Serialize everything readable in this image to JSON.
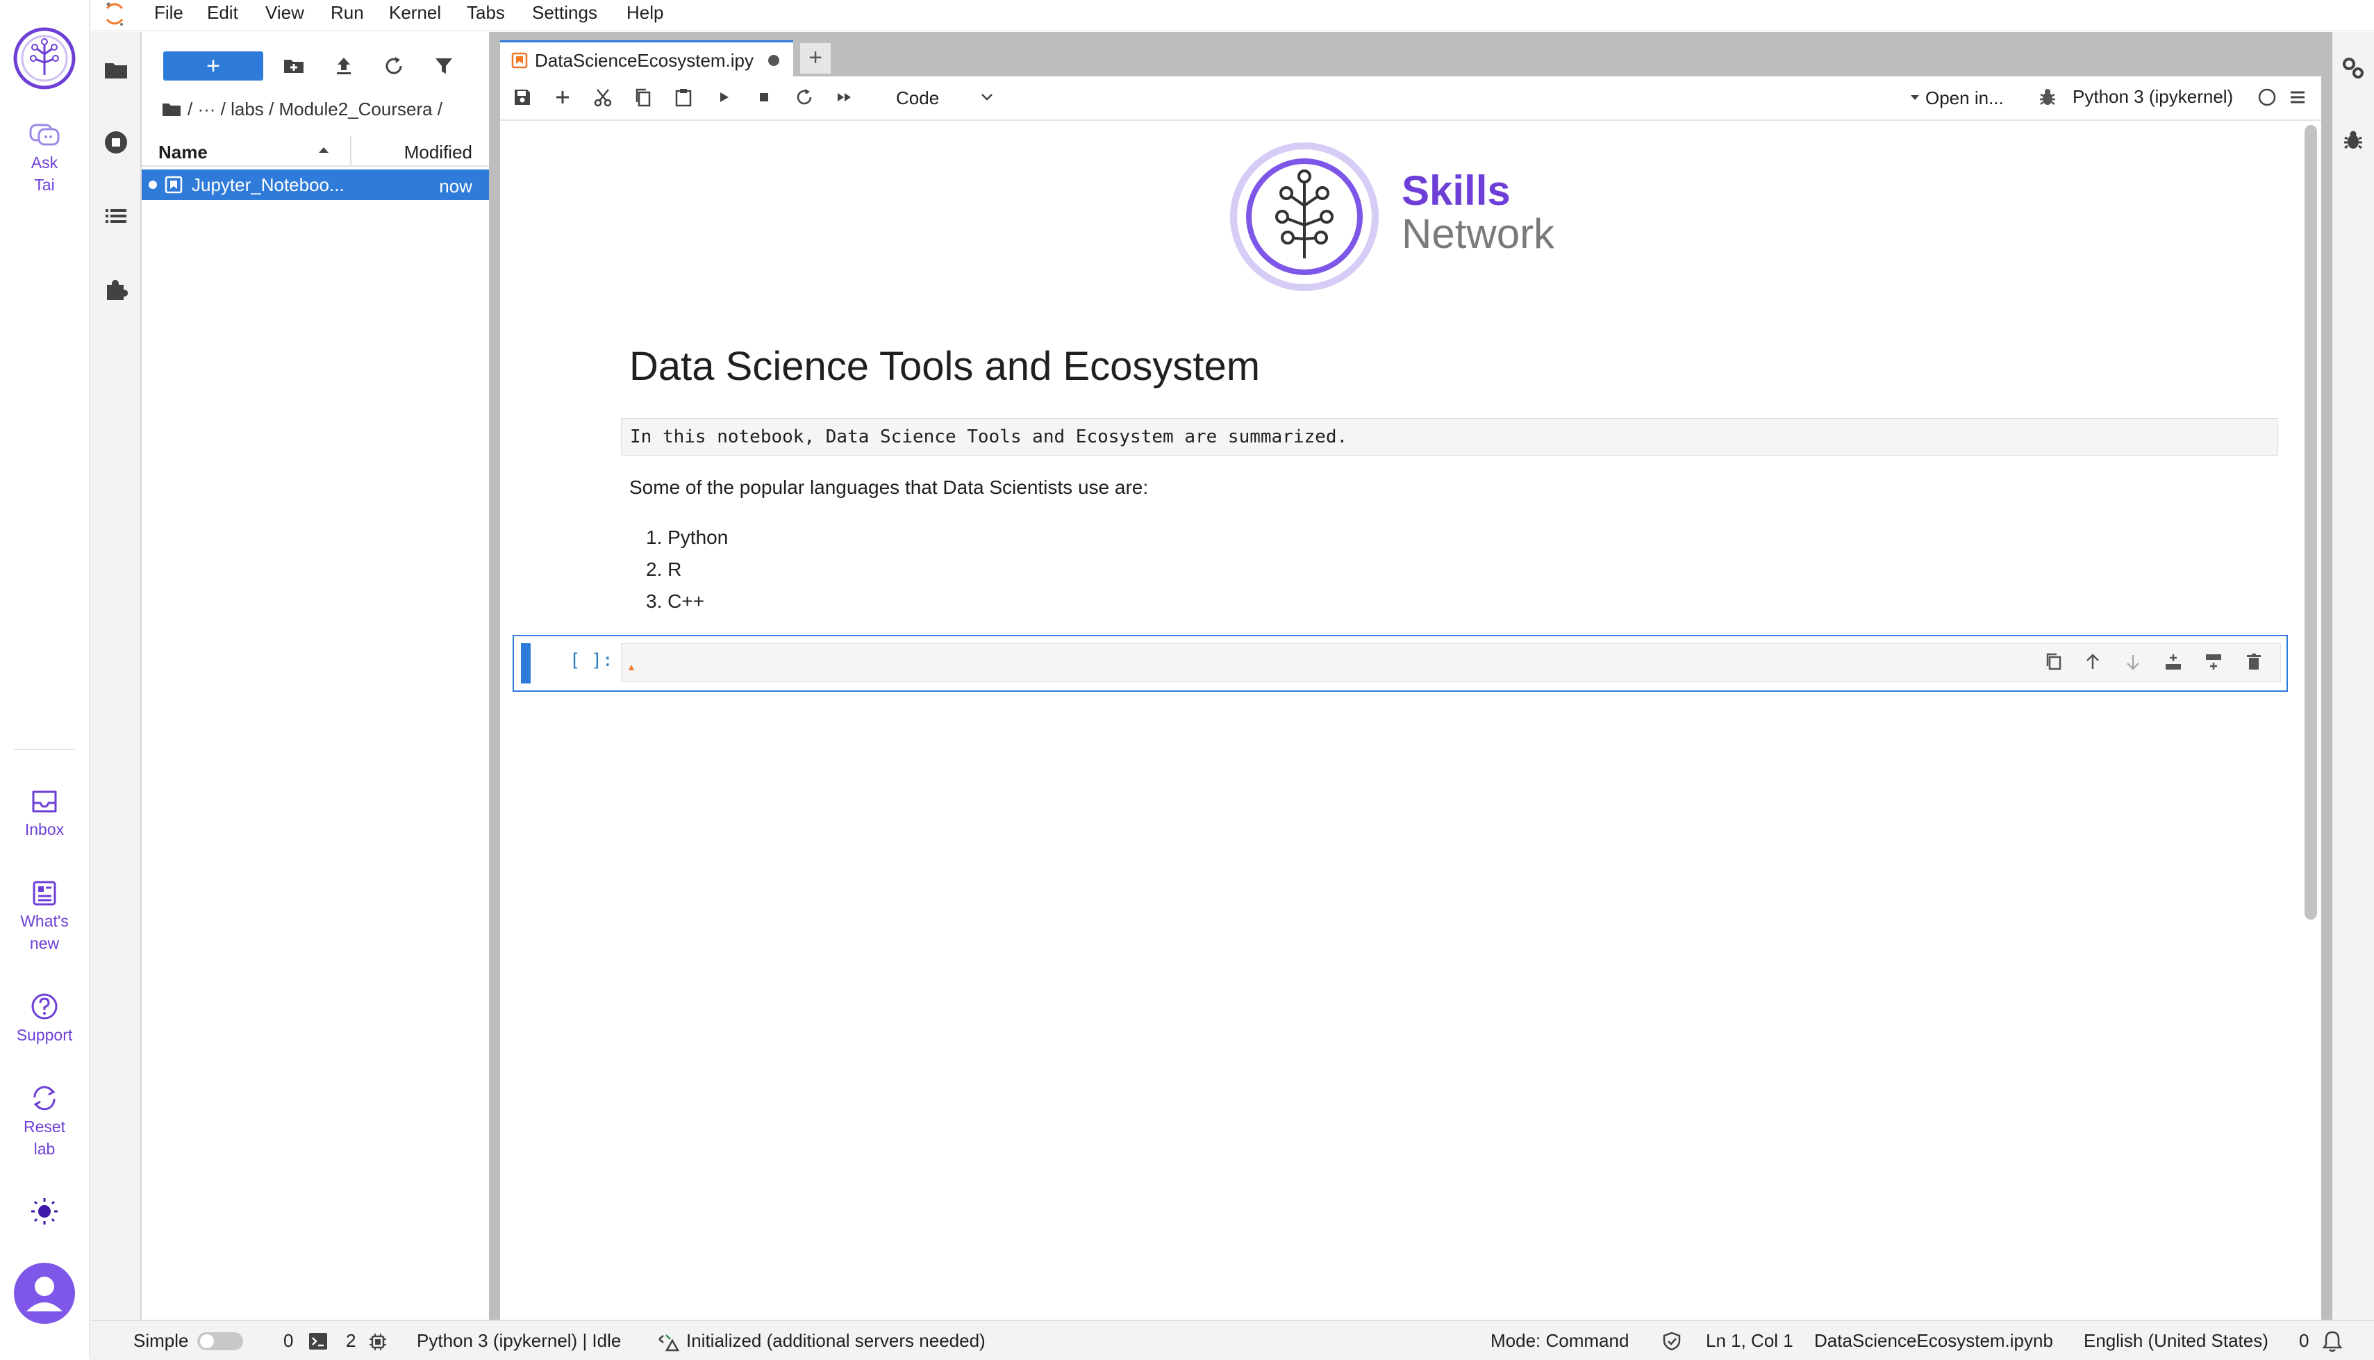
{
  "rail": {
    "ask_tai": "Ask Tai",
    "inbox": "Inbox",
    "whats_new": "What's new",
    "support": "Support",
    "reset_lab": "Reset lab"
  },
  "menu": [
    "File",
    "Edit",
    "View",
    "Run",
    "Kernel",
    "Tabs",
    "Settings",
    "Help"
  ],
  "filebrowser": {
    "new_label": "+",
    "breadcrumb": "/   ···   / labs / Module2_Coursera /",
    "col_name": "Name",
    "col_modified": "Modified",
    "rows": [
      {
        "name": "Jupyter_Noteboo...",
        "modified": "now"
      }
    ]
  },
  "notebook": {
    "tab_title": "DataScienceEcosystem.ipy",
    "tab_add": "+",
    "cell_type": "Code",
    "open_in": "Open in...",
    "kernel": "Python 3 (ipykernel)",
    "logo_line1": "Skills",
    "logo_line2": "Network",
    "title": "Data Science Tools and Ecosystem",
    "raw_text": "In this notebook, Data Science Tools and Ecosystem are summarized.",
    "intro": "Some of the popular languages that Data Scientists use are:",
    "languages": [
      "1. Python",
      "2. R",
      "3. C++"
    ],
    "prompt": "[ ]:"
  },
  "status": {
    "simple": "Simple",
    "terminals": "0",
    "kernels": "2",
    "kernel_status": "Python 3 (ipykernel) | Idle",
    "lsp": "Initialized (additional servers needed)",
    "mode": "Mode: Command",
    "position": "Ln 1, Col 1",
    "filename": "DataScienceEcosystem.ipynb",
    "language": "English (United States)",
    "notifications": "0"
  },
  "colors": {
    "accent": "#2f7bd9",
    "brand_purple": "#6d3fd6",
    "dirty_dot": "#555555"
  }
}
